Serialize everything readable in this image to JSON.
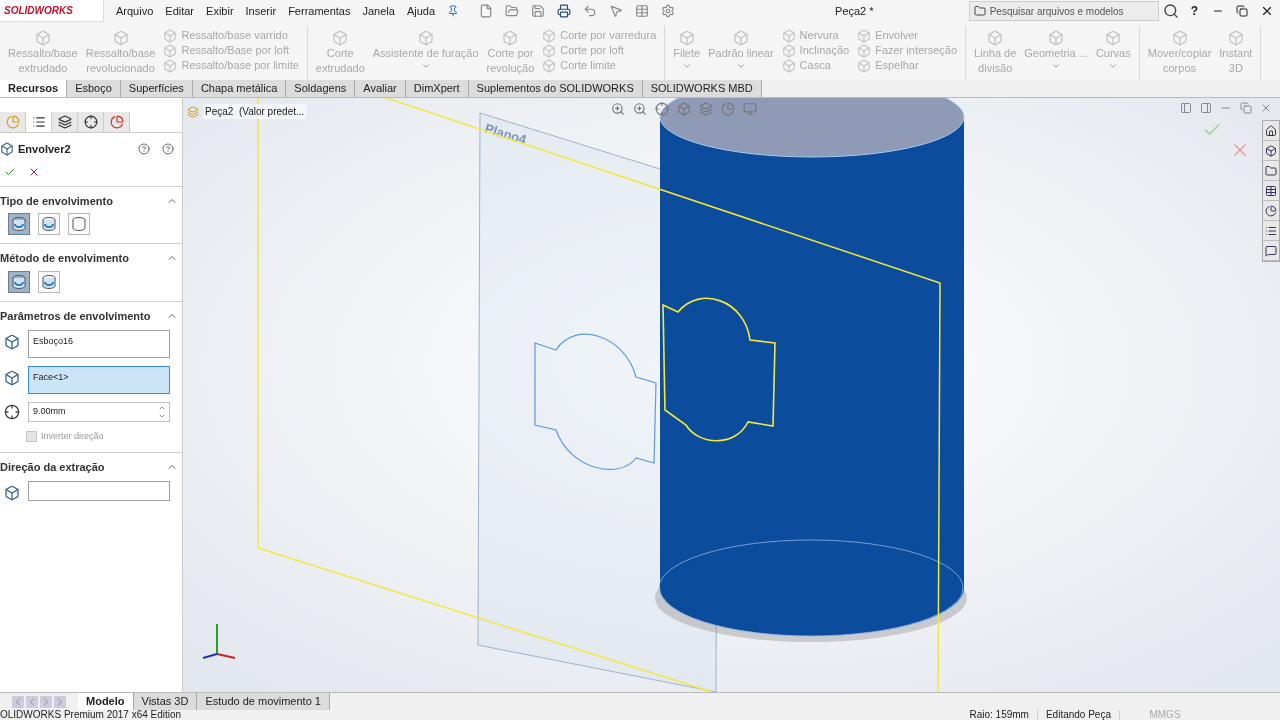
{
  "logo": "SOLIDWORKS",
  "menu": [
    "Arquivo",
    "Editar",
    "Exibir",
    "Inserir",
    "Ferramentas",
    "Janela",
    "Ajuda"
  ],
  "title": "Peça2 *",
  "search": {
    "placeholder": "Pesquisar arquivos e modelos"
  },
  "help": "?",
  "ribbon": [
    [
      {
        "kind": "large",
        "label": "Ressalto/base\nextrudado",
        "disabled": true
      },
      {
        "kind": "large",
        "label": "Ressalto/base\nrevolucionado",
        "disabled": true
      },
      {
        "kind": "stack",
        "items": [
          {
            "label": "Ressalto/base varrido",
            "disabled": true
          },
          {
            "label": "Ressalto/Base por loft",
            "disabled": true
          },
          {
            "label": "Ressalto/base por limite",
            "disabled": true
          }
        ]
      }
    ],
    [
      {
        "kind": "large",
        "label": "Corte\nextrudado",
        "disabled": true
      },
      {
        "kind": "large",
        "label": "Assistente de furação",
        "dropdown": true,
        "disabled": true
      },
      {
        "kind": "large",
        "label": "Corte por\nrevolução",
        "disabled": true
      },
      {
        "kind": "stack",
        "items": [
          {
            "label": "Corte por varredura",
            "disabled": true
          },
          {
            "label": "Corte por loft",
            "disabled": true
          },
          {
            "label": "Corte limite",
            "disabled": true
          }
        ]
      }
    ],
    [
      {
        "kind": "large",
        "label": "Filete",
        "dropdown": true,
        "disabled": true
      },
      {
        "kind": "large",
        "label": "Padrão linear",
        "dropdown": true,
        "disabled": true
      },
      {
        "kind": "stack",
        "items": [
          {
            "label": "Nervura",
            "disabled": true
          },
          {
            "label": "Inclinação",
            "disabled": true
          },
          {
            "label": "Casca",
            "disabled": true
          }
        ]
      },
      {
        "kind": "stack",
        "items": [
          {
            "label": "Envolver",
            "disabled": true
          },
          {
            "label": "Fazer interseção",
            "disabled": true
          },
          {
            "label": "Espelhar",
            "disabled": true
          }
        ]
      }
    ],
    [
      {
        "kind": "large",
        "label": "Linha de\ndivisão",
        "disabled": true
      },
      {
        "kind": "large",
        "label": "Geometria ...",
        "dropdown": true,
        "disabled": true
      },
      {
        "kind": "large",
        "label": "Curvas",
        "dropdown": true,
        "disabled": true
      }
    ],
    [
      {
        "kind": "large",
        "label": "Mover/copiar\ncorpos",
        "disabled": true
      },
      {
        "kind": "large",
        "label": "Instant\n3D",
        "disabled": true
      }
    ]
  ],
  "command_tabs": [
    {
      "label": "Recursos",
      "selected": true
    },
    {
      "label": "Esboço",
      "selected": false
    },
    {
      "label": "Superfícies",
      "selected": false
    },
    {
      "label": "Chapa metálica",
      "selected": false
    },
    {
      "label": "Soldagens",
      "selected": false
    },
    {
      "label": "Avaliar",
      "selected": false
    },
    {
      "label": "DimXpert",
      "selected": false
    },
    {
      "label": "Suplementos do SOLIDWORKS",
      "selected": false
    },
    {
      "label": "SOLIDWORKS MBD",
      "selected": false
    }
  ],
  "manager_tabs": [
    {
      "selected": false
    },
    {
      "selected": true
    },
    {
      "selected": false
    },
    {
      "selected": false
    },
    {
      "selected": false
    }
  ],
  "feature_title": "Envolver2",
  "sections": [
    {
      "kind": "options",
      "title": "Tipo de envolvimento",
      "expanded": true,
      "options": [
        {
          "selected": true
        },
        {
          "selected": false
        },
        {
          "selected": false
        }
      ]
    },
    {
      "kind": "method",
      "title": "Método de envolvimento",
      "expanded": true,
      "options": [
        {
          "selected": true
        },
        {
          "selected": false
        }
      ]
    },
    {
      "kind": "params",
      "title": "Parâmetros de envolvimento",
      "expanded": true,
      "fields": [
        {
          "kind": "list",
          "value": "Esboço16",
          "active": false
        },
        {
          "kind": "list",
          "value": "Face<1>",
          "active": true
        },
        {
          "kind": "number",
          "value": "9.00mm"
        },
        {
          "kind": "checkbox",
          "label": "Inverter direção",
          "checked": false,
          "disabled": true
        }
      ]
    },
    {
      "kind": "params",
      "title": "Direção da extração",
      "expanded": true,
      "fields": [
        {
          "kind": "list",
          "active": false
        }
      ]
    }
  ],
  "viewport": {
    "tree_node": "Peça2  (Valor predet...",
    "plane_label": "Plano4"
  },
  "model_tabs": [
    {
      "label": "Modelo",
      "selected": true
    },
    {
      "label": "Vistas 3D",
      "selected": false
    },
    {
      "label": "Estudo de movimento 1",
      "selected": false
    }
  ],
  "status": [
    "OLIDWORKS Premium 2017 x64 Edition",
    "Raio: 159mm",
    "Editando Peça",
    "MMGS"
  ]
}
